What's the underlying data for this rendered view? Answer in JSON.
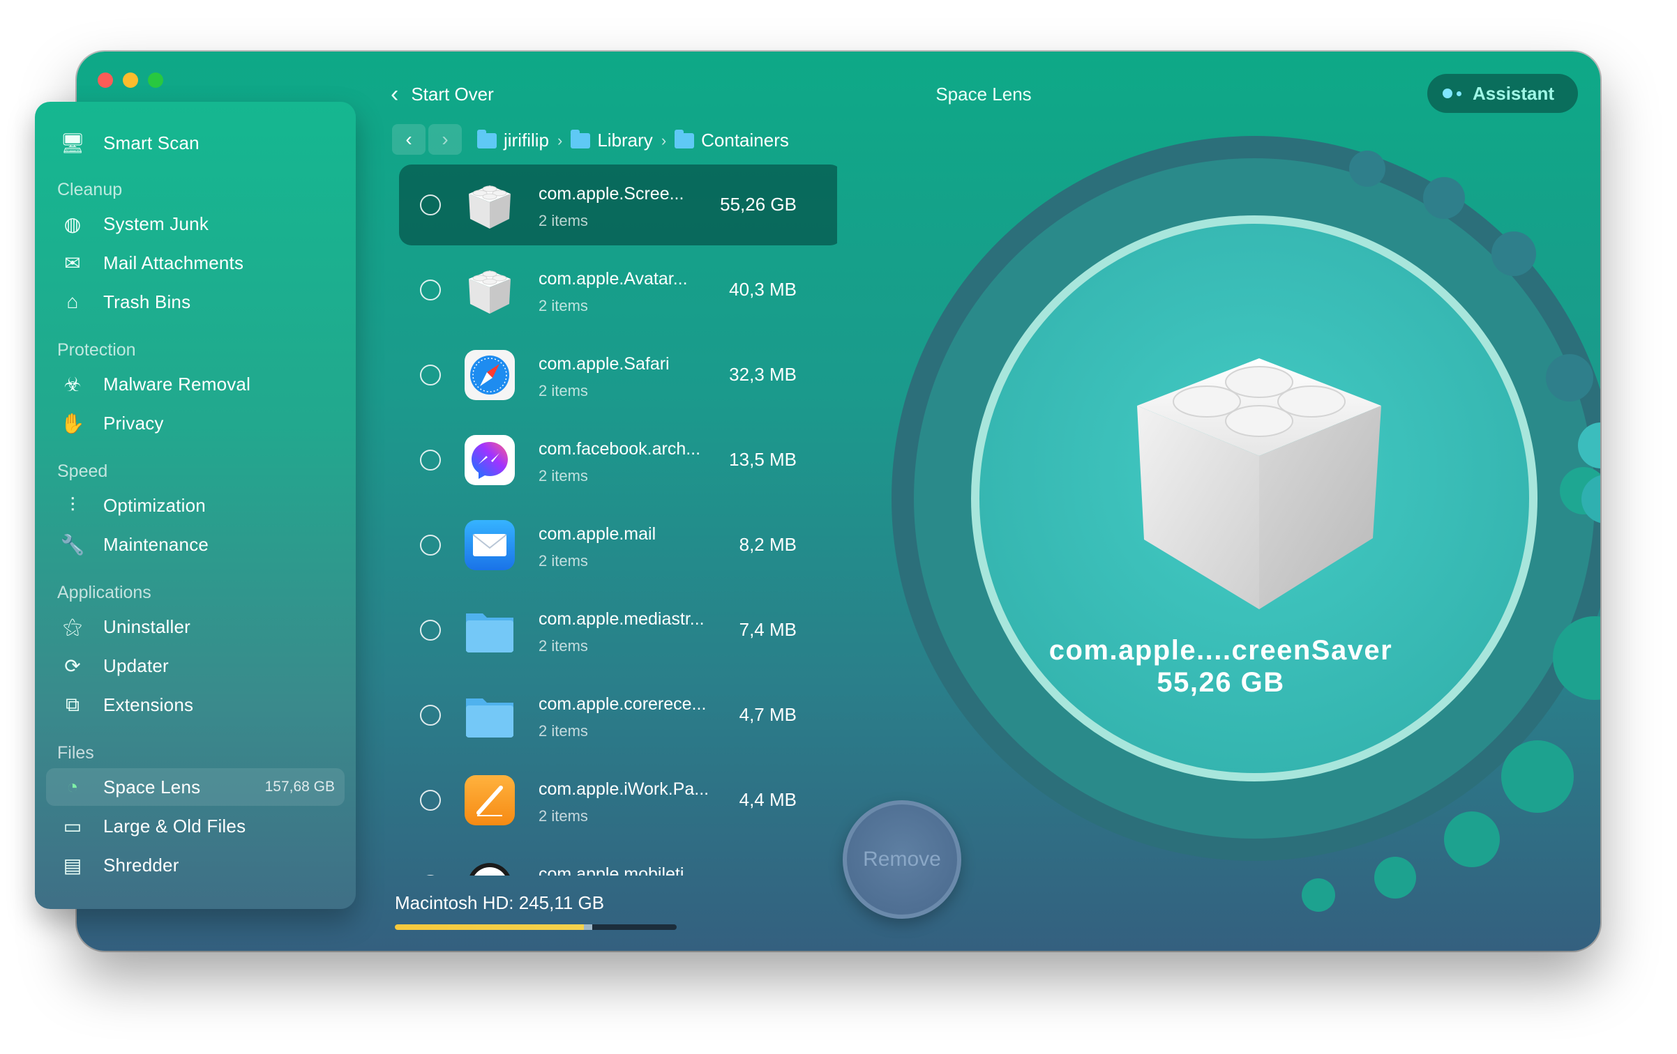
{
  "app": {
    "title": "Space Lens"
  },
  "header": {
    "start_over": "Start Over",
    "assistant": "Assistant"
  },
  "breadcrumb": [
    "jirifilip",
    "Library",
    "Containers"
  ],
  "sidebar": {
    "top": {
      "label": "Smart Scan",
      "icon": "monitor-icon"
    },
    "sections": [
      {
        "title": "Cleanup",
        "items": [
          {
            "label": "System Junk",
            "icon": "system-junk-icon"
          },
          {
            "label": "Mail Attachments",
            "icon": "mail-icon"
          },
          {
            "label": "Trash Bins",
            "icon": "trash-icon"
          }
        ]
      },
      {
        "title": "Protection",
        "items": [
          {
            "label": "Malware Removal",
            "icon": "biohazard-icon"
          },
          {
            "label": "Privacy",
            "icon": "hand-icon"
          }
        ]
      },
      {
        "title": "Speed",
        "items": [
          {
            "label": "Optimization",
            "icon": "sliders-icon"
          },
          {
            "label": "Maintenance",
            "icon": "wrench-icon"
          }
        ]
      },
      {
        "title": "Applications",
        "items": [
          {
            "label": "Uninstaller",
            "icon": "uninstaller-icon"
          },
          {
            "label": "Updater",
            "icon": "updater-icon"
          },
          {
            "label": "Extensions",
            "icon": "extensions-icon"
          }
        ]
      },
      {
        "title": "Files",
        "items": [
          {
            "label": "Space Lens",
            "icon": "space-lens-icon",
            "meta": "157,68 GB",
            "active": true
          },
          {
            "label": "Large & Old Files",
            "icon": "folder-icon"
          },
          {
            "label": "Shredder",
            "icon": "shredder-icon"
          }
        ]
      }
    ]
  },
  "items": [
    {
      "name": "com.apple.Scree...",
      "count": "2 items",
      "size": "55,26 GB",
      "icon": "lego-brick-icon",
      "selected": true
    },
    {
      "name": "com.apple.Avatar...",
      "count": "2 items",
      "size": "40,3 MB",
      "icon": "lego-brick-icon"
    },
    {
      "name": "com.apple.Safari",
      "count": "2 items",
      "size": "32,3 MB",
      "icon": "safari-icon"
    },
    {
      "name": "com.facebook.arch...",
      "count": "2 items",
      "size": "13,5 MB",
      "icon": "messenger-icon"
    },
    {
      "name": "com.apple.mail",
      "count": "2 items",
      "size": "8,2 MB",
      "icon": "mail-app-icon"
    },
    {
      "name": "com.apple.mediastr...",
      "count": "2 items",
      "size": "7,4 MB",
      "icon": "folder-icon"
    },
    {
      "name": "com.apple.corerece...",
      "count": "2 items",
      "size": "4,7 MB",
      "icon": "folder-icon"
    },
    {
      "name": "com.apple.iWork.Pa...",
      "count": "2 items",
      "size": "4,4 MB",
      "icon": "pages-icon"
    },
    {
      "name": "com.apple.mobileti...",
      "count": "",
      "size": "",
      "icon": "clock-icon"
    }
  ],
  "disk": {
    "label": "Macintosh HD: 245,11 GB",
    "used_fraction": 0.7
  },
  "lens": {
    "name": "com.apple....creenSaver",
    "size": "55,26 GB"
  },
  "remove_label": "Remove",
  "colors": {
    "accent": "#0ea987",
    "assistant_text": "#9ff7e6",
    "disk_fill": "#f7c93d"
  }
}
